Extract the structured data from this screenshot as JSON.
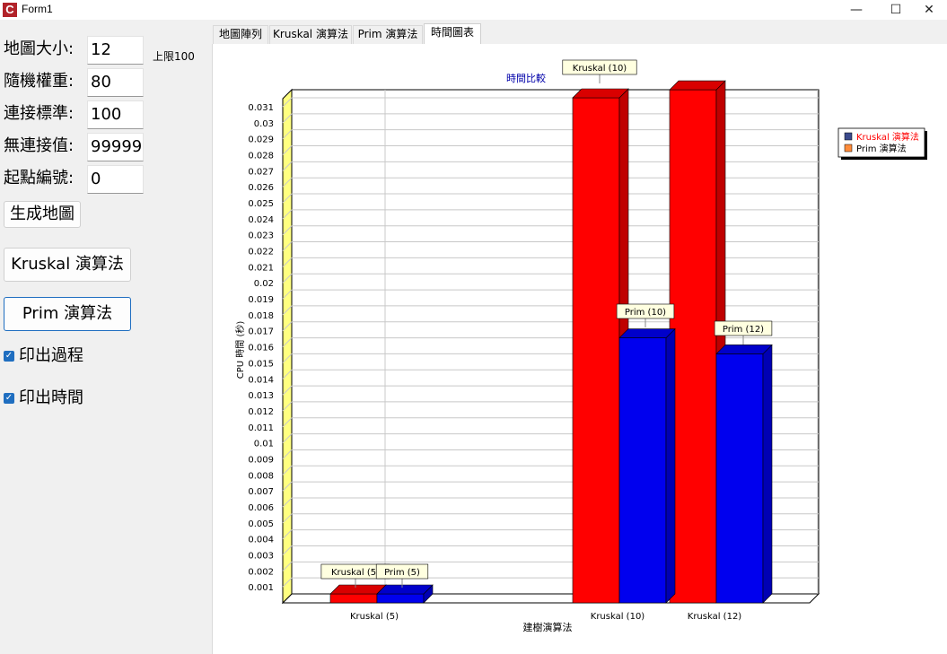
{
  "window": {
    "title": "Form1",
    "icon_letter": "C",
    "minimize_glyph": "—",
    "maximize_glyph": "☐",
    "close_glyph": "✕"
  },
  "form": {
    "map_size": {
      "label": "地圖大小:",
      "value": "12",
      "limit_label": "上限100"
    },
    "random_weight": {
      "label": "隨機權重:",
      "value": "80"
    },
    "connect_standard": {
      "label": "連接標準:",
      "value": "100"
    },
    "no_connect_value": {
      "label": "無連接值:",
      "value": "99999"
    },
    "start_node": {
      "label": "起點編號:",
      "value": "0"
    },
    "generate_button": "生成地圖",
    "kruskal_button": "Kruskal 演算法",
    "prim_button": "Prim 演算法",
    "print_process": {
      "label": "印出過程",
      "checked": true
    },
    "print_time": {
      "label": "印出時間",
      "checked": true
    }
  },
  "tabs": [
    {
      "label": "地圖陣列",
      "active": false
    },
    {
      "label": "Kruskal 演算法",
      "active": false
    },
    {
      "label": "Prim 演算法",
      "active": false
    },
    {
      "label": "時間圖表",
      "active": true
    }
  ],
  "colors": {
    "kruskal": "#ff0000",
    "prim": "#0000ee",
    "title": "#0000aa",
    "legend_square_kruskal": "#3b4a8c",
    "legend_square_prim": "#ff8c3a",
    "checkbox": "#1f6ec0"
  },
  "chart_data": {
    "type": "bar",
    "title": "時間比較",
    "xlabel": "建樹演算法",
    "ylabel": "CPU 時間 (秒)",
    "categories": [
      "Kruskal (5)",
      "Kruskal (10)",
      "Kruskal (12)"
    ],
    "series": [
      {
        "name": "Kruskal 演算法",
        "values": [
          0,
          0.031,
          0.0315
        ],
        "labels": [
          "Kruskal (5)",
          "Kruskal (10)",
          ""
        ]
      },
      {
        "name": "Prim 演算法",
        "values": [
          0,
          0.016,
          0.015
        ],
        "labels": [
          "Prim (5)",
          "Prim (10)",
          "Prim (12)"
        ]
      }
    ],
    "ylim": [
      0,
      0.031
    ],
    "yticks": [
      "0.001",
      "0.002",
      "0.003",
      "0.004",
      "0.005",
      "0.006",
      "0.007",
      "0.008",
      "0.009",
      "0.01",
      "0.011",
      "0.012",
      "0.013",
      "0.014",
      "0.015",
      "0.016",
      "0.017",
      "0.018",
      "0.019",
      "0.02",
      "0.021",
      "0.022",
      "0.023",
      "0.024",
      "0.025",
      "0.026",
      "0.027",
      "0.028",
      "0.029",
      "0.03",
      "0.031"
    ],
    "grid": true,
    "legend_position": "right",
    "style": "3d"
  }
}
